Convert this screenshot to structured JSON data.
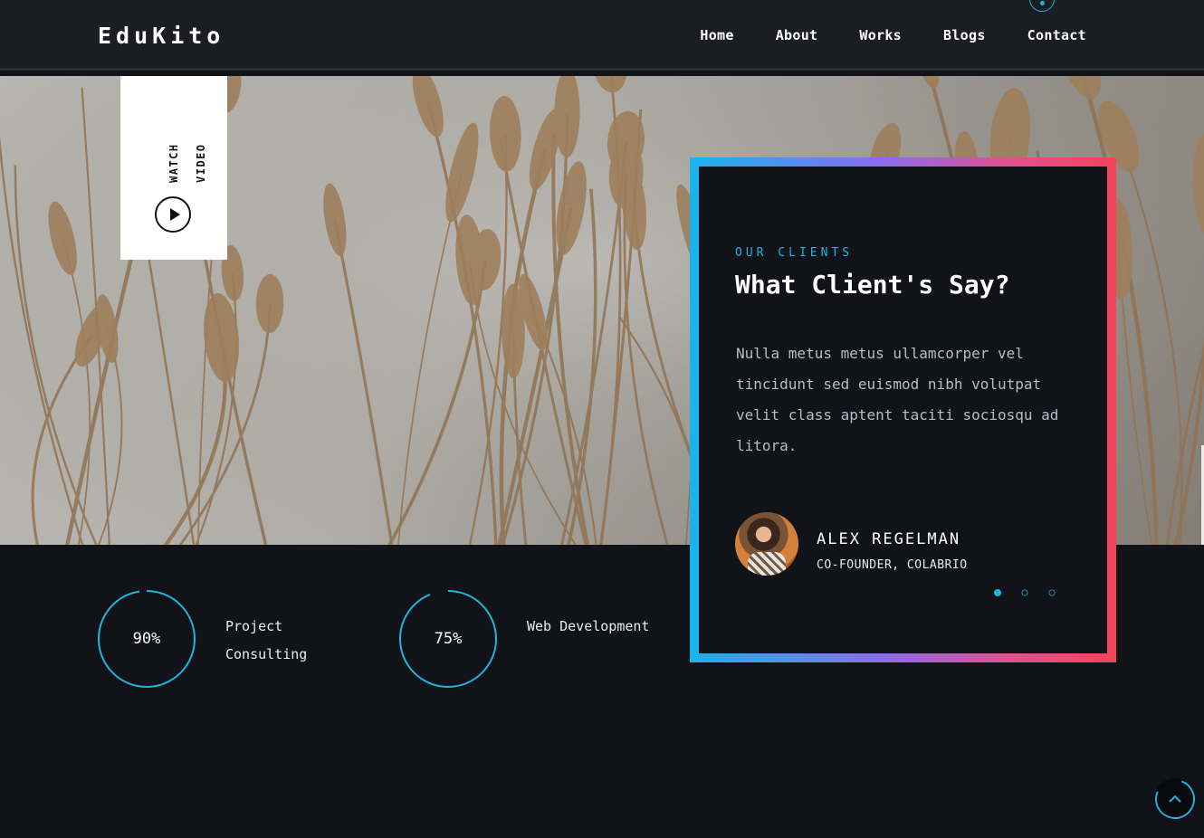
{
  "header": {
    "logo": "EduKito",
    "nav": [
      "Home",
      "About",
      "Works",
      "Blogs",
      "Contact"
    ]
  },
  "hero": {
    "watch_label": "WATCH VIDEO"
  },
  "testimonial": {
    "kicker": "OUR CLIENTS",
    "title": "What Client's Say?",
    "quote": "Nulla metus metus ullamcorper vel tincidunt sed euismod nibh volutpat velit class aptent taciti sociosqu ad litora.",
    "author_name": "ALEX REGELMAN",
    "author_role": "CO-FOUNDER, COLABRIO",
    "slide_count": 3,
    "active_slide": 1
  },
  "stats": [
    {
      "value": "90%",
      "label": "Project Consulting",
      "percent": 90
    },
    {
      "value": "75%",
      "label": "Web Development",
      "percent": 75
    }
  ],
  "colors": {
    "accent": "#1fb3e0",
    "background": "#111318",
    "header": "#1b1d22",
    "gradient_start": "#19b4ec",
    "gradient_end": "#f2445a"
  },
  "icons": [
    "play-icon",
    "arrow-up-icon"
  ]
}
